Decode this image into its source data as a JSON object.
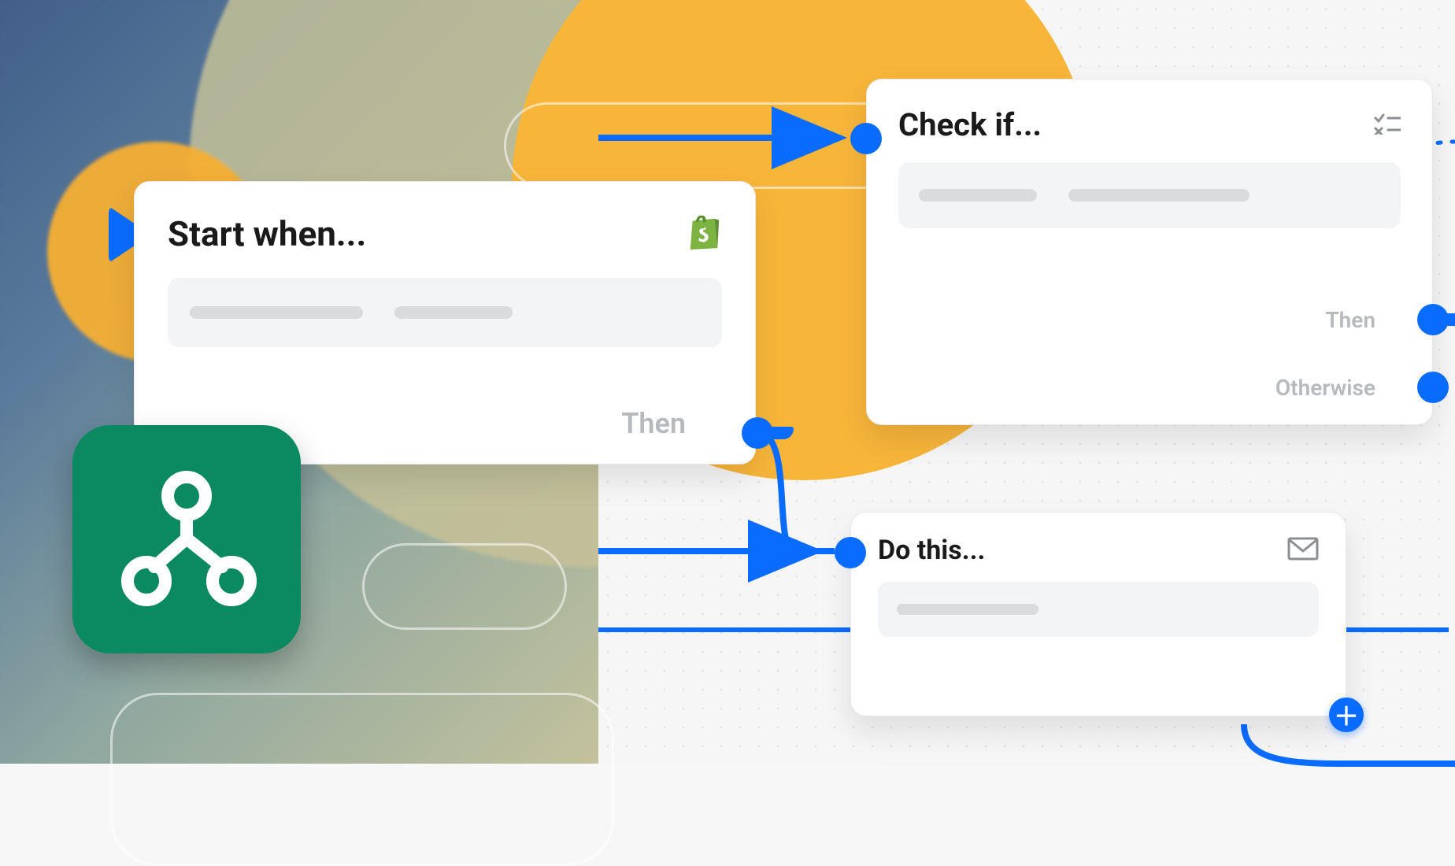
{
  "nodes": {
    "start": {
      "title": "Start when...",
      "outputs": {
        "then": "Then"
      },
      "integration_icon": "shopify-bag-icon"
    },
    "condition": {
      "title": "Check if...",
      "outputs": {
        "then": "Then",
        "otherwise": "Otherwise"
      },
      "header_icon": "checklist-icon"
    },
    "action": {
      "title": "Do this...",
      "header_icon": "mail-icon"
    }
  },
  "icons": {
    "app_tile": "flow-branch-icon",
    "add": "plus-icon"
  },
  "colors": {
    "accent": "#0a6cff",
    "app_green": "#0b8a62",
    "highlight_yellow": "#f7b53a"
  }
}
